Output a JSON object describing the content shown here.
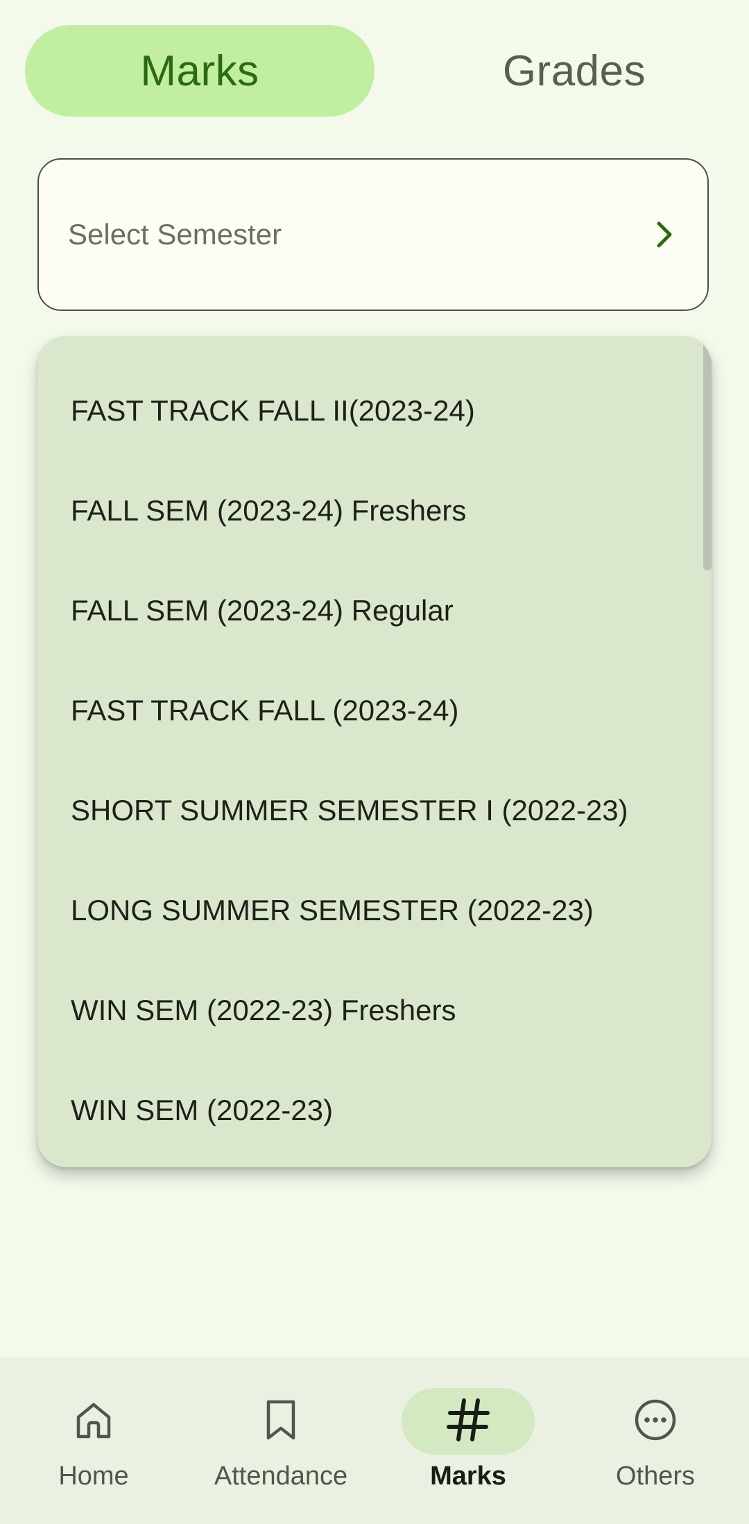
{
  "tabs": {
    "marks": "Marks",
    "grades": "Grades"
  },
  "select": {
    "placeholder": "Select Semester"
  },
  "dropdown": {
    "items": [
      "FAST TRACK FALL II(2023-24)",
      "FALL SEM (2023-24) Freshers",
      "FALL SEM (2023-24) Regular",
      "FAST TRACK FALL (2023-24)",
      "SHORT SUMMER SEMESTER I (2022-23)",
      "LONG SUMMER SEMESTER (2022-23)",
      "WIN SEM (2022-23) Freshers",
      "WIN SEM (2022-23)"
    ]
  },
  "nav": {
    "home": "Home",
    "attendance": "Attendance",
    "marks": "Marks",
    "others": "Others",
    "active": "marks"
  },
  "colors": {
    "accent": "#2b6a0d",
    "tab_active_bg": "#c1eea1",
    "dropdown_bg": "#dae7cc",
    "page_bg": "#f3faec"
  },
  "icons": {
    "home": "home-icon",
    "attendance": "bookmark-icon",
    "marks": "hash-icon",
    "others": "more-horizontal-icon",
    "select": "chevron-right-icon"
  }
}
